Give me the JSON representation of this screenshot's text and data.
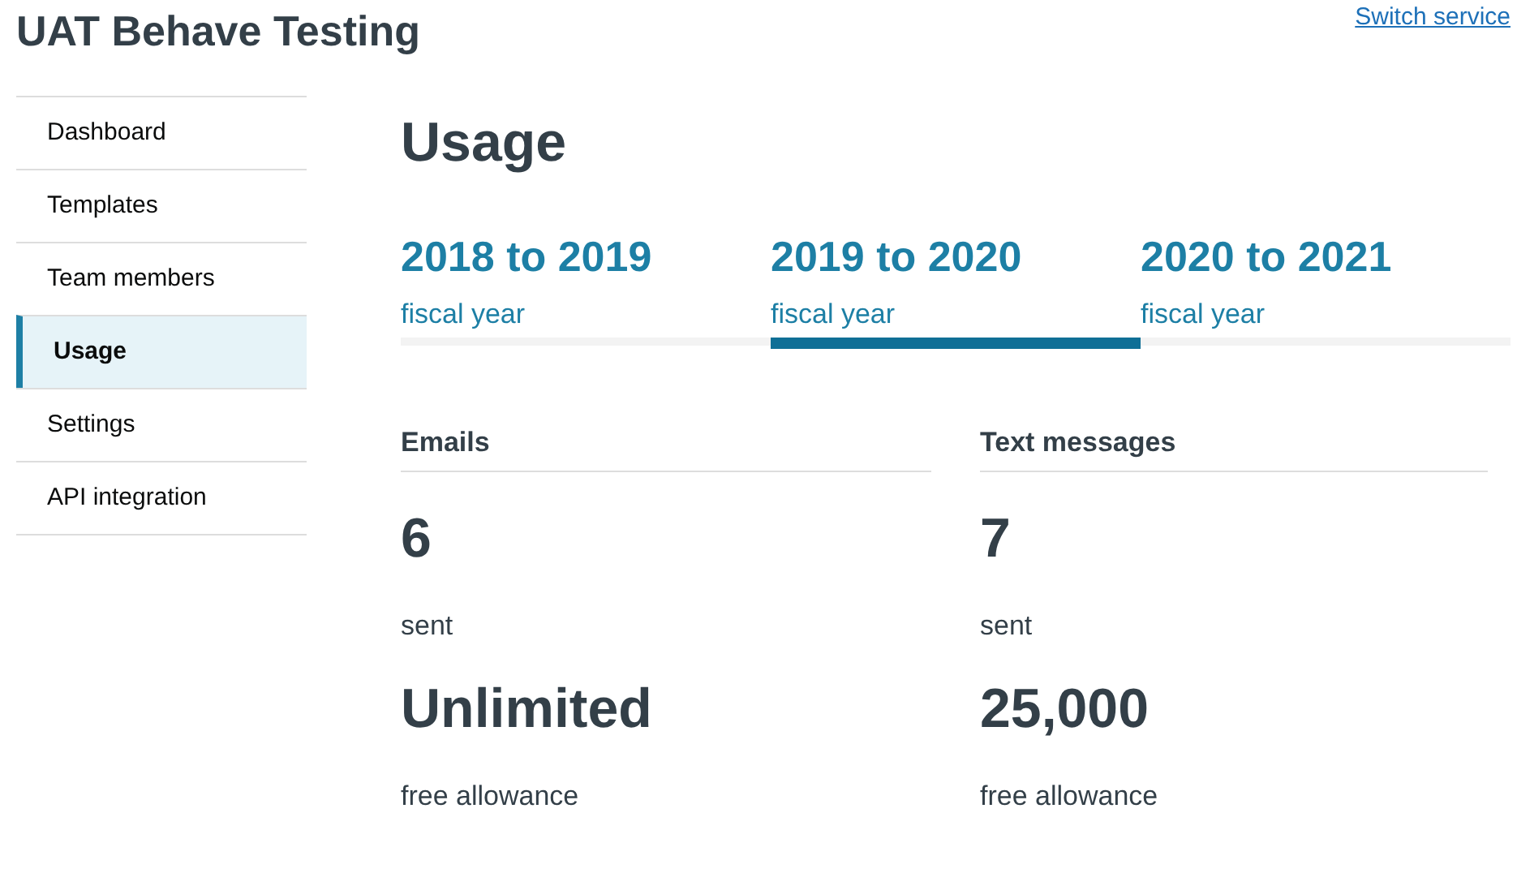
{
  "header": {
    "title": "UAT Behave Testing",
    "link": "Switch service"
  },
  "sidebar": {
    "items": [
      {
        "label": "Dashboard",
        "selected": false
      },
      {
        "label": "Templates",
        "selected": false
      },
      {
        "label": "Team members",
        "selected": false
      },
      {
        "label": "Usage",
        "selected": true
      },
      {
        "label": "Settings",
        "selected": false
      },
      {
        "label": "API integration",
        "selected": false
      }
    ]
  },
  "main": {
    "heading": "Usage",
    "tabs": [
      {
        "label": "2018 to 2019",
        "caption": "fiscal year",
        "selected": false
      },
      {
        "label": "2019 to 2020",
        "caption": "fiscal year",
        "selected": true
      },
      {
        "label": "2020 to 2021",
        "caption": "fiscal year",
        "selected": false
      }
    ],
    "columns": [
      {
        "heading": "Emails",
        "sent": "6",
        "sent_label": "sent",
        "allowance": "Unlimited",
        "allowance_label": "free allowance"
      },
      {
        "heading": "Text messages",
        "sent": "7",
        "sent_label": "sent",
        "allowance": "25,000",
        "allowance_label": "free allowance"
      }
    ]
  }
}
